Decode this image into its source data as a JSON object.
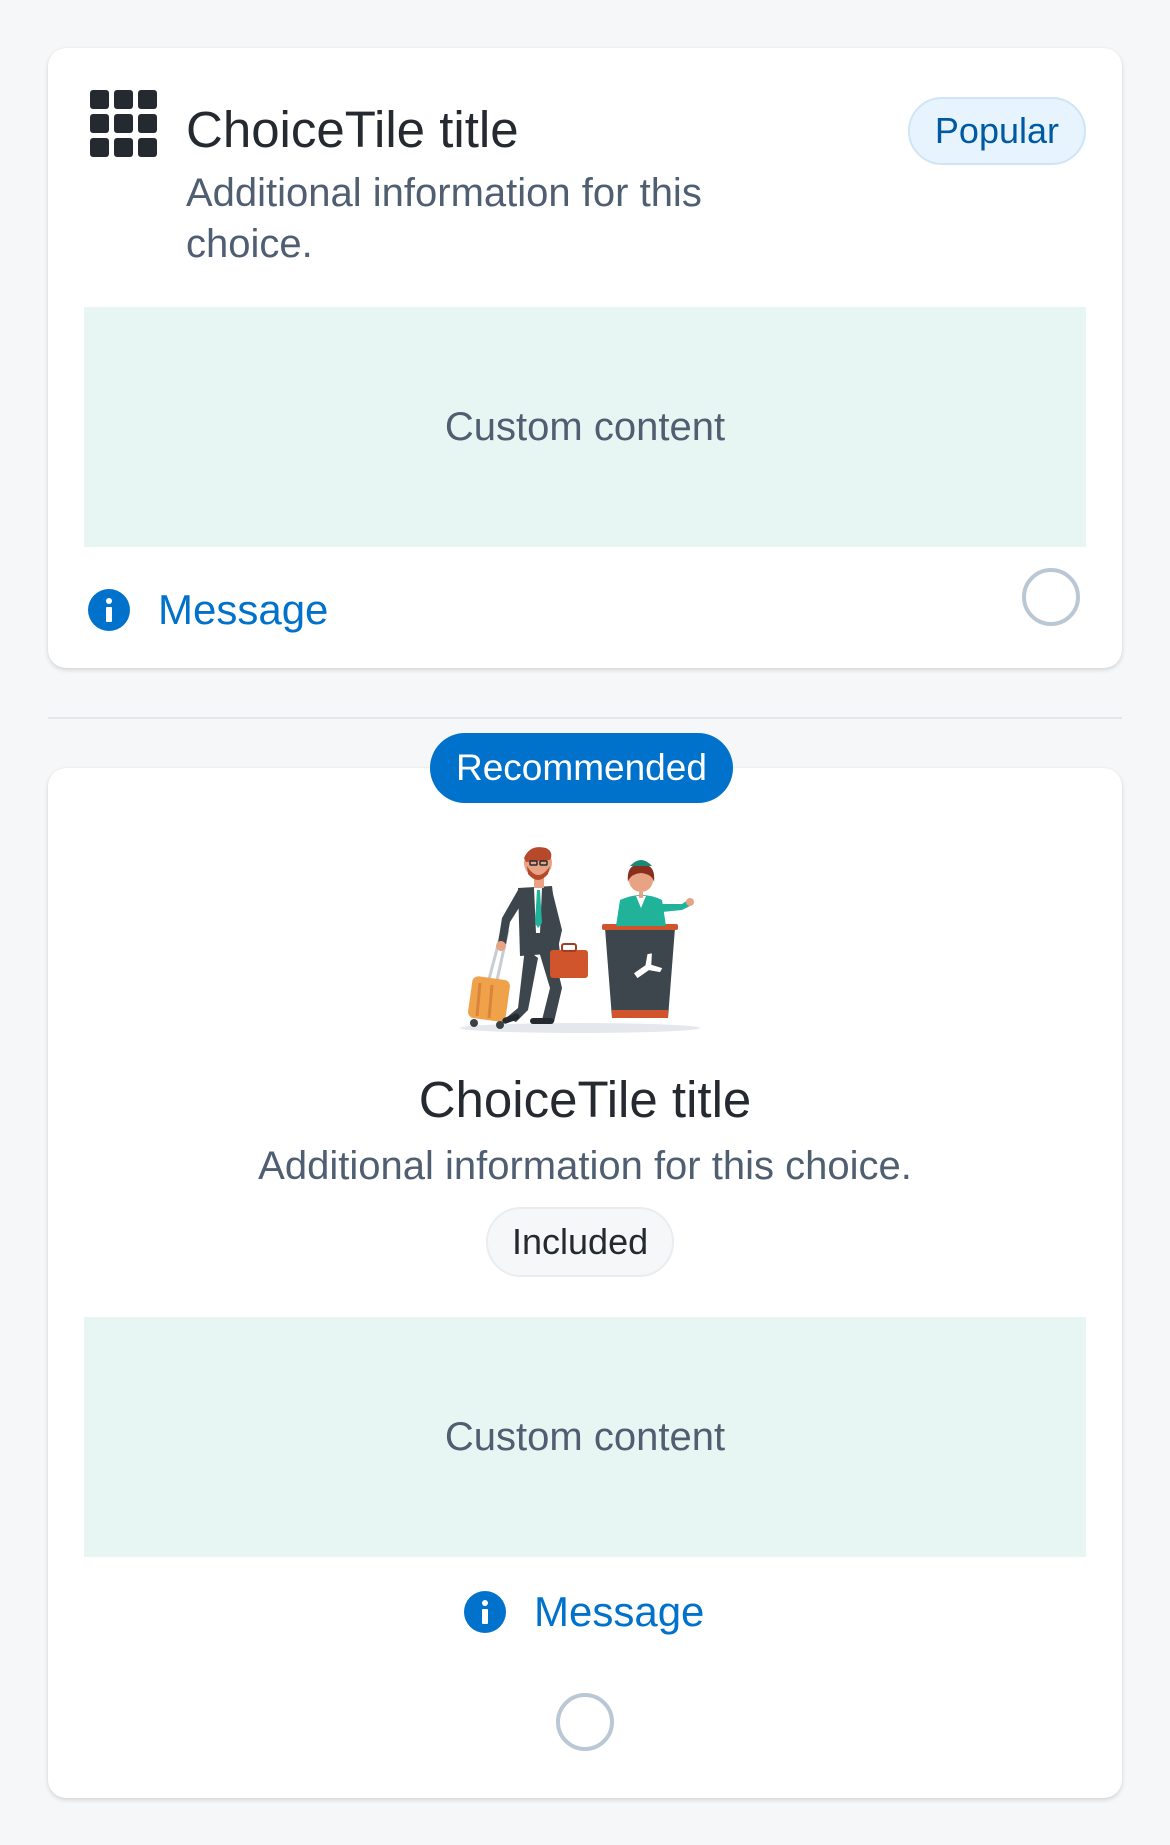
{
  "tile_popular": {
    "icon": "grid-icon",
    "title": "ChoiceTile title",
    "description": "Additional information for this choice.",
    "badge": "Popular",
    "custom_content": "Custom content",
    "message": "Message",
    "selected": false
  },
  "tile_recommended": {
    "top_badge": "Recommended",
    "illustration": "airport-check-in-illustration",
    "title": "ChoiceTile title",
    "description": "Additional information for this choice.",
    "badge": "Included",
    "custom_content": "Custom content",
    "message": "Message",
    "selected": false
  },
  "colors": {
    "primary": "#0172cb",
    "custom_bg": "#e8f6f3",
    "badge_info_bg": "#e8f4fd",
    "text_primary": "#252a31",
    "text_secondary": "#4f5e71",
    "radio_border": "#bac7d5"
  }
}
